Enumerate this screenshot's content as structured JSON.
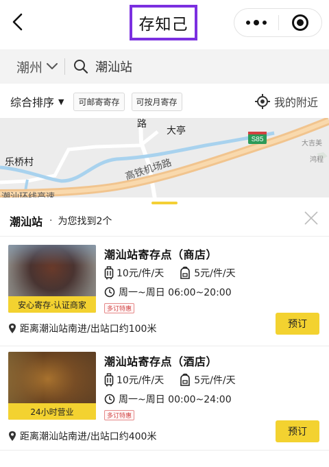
{
  "header": {
    "title": "存知己",
    "back_icon": "chevron-left-icon",
    "more_icon": "more-dots-icon",
    "close_icon": "target-circle-icon"
  },
  "search": {
    "city": "潮州",
    "query": "潮汕站"
  },
  "filters": {
    "sort_label": "综合排序",
    "sort_caret": "▼",
    "chips": [
      "可邮寄寄存",
      "可按月寄存"
    ],
    "nearby_label": "我的附近"
  },
  "map": {
    "labels": {
      "road_top": "路",
      "town": "大亭",
      "village": "乐桥村",
      "highway_road": "高铁机场路",
      "expressway": "S85",
      "bottom_fragment": "潮汕环线高速"
    },
    "small_labels": [
      "大吉美",
      "鸿程"
    ]
  },
  "results": {
    "station": "潮汕站",
    "separator": "·",
    "found_text": "为您找到2个"
  },
  "colors": {
    "accent_yellow": "#f3d230",
    "title_outline": "#7b2fe0",
    "tag_red": "#d24848"
  },
  "stores": [
    {
      "name": "潮汕站寄存点（商店）",
      "banner": "安心寄存·认证商家",
      "luggage_price": "10元/件/天",
      "bag_price": "5元/件/天",
      "hours": "周一~周日 06:00~20:00",
      "tag": "多订特惠",
      "distance": "距离潮汕站南进/出站口约100米",
      "book_label": "预订"
    },
    {
      "name": "潮汕站寄存点（酒店）",
      "banner": "24小时营业",
      "luggage_price": "10元/件/天",
      "bag_price": "5元/件/天",
      "hours": "周一~周日 00:00~24:00",
      "tag": "多订特惠",
      "distance": "距离潮汕站南进/出站口约400米",
      "book_label": "预订"
    }
  ]
}
